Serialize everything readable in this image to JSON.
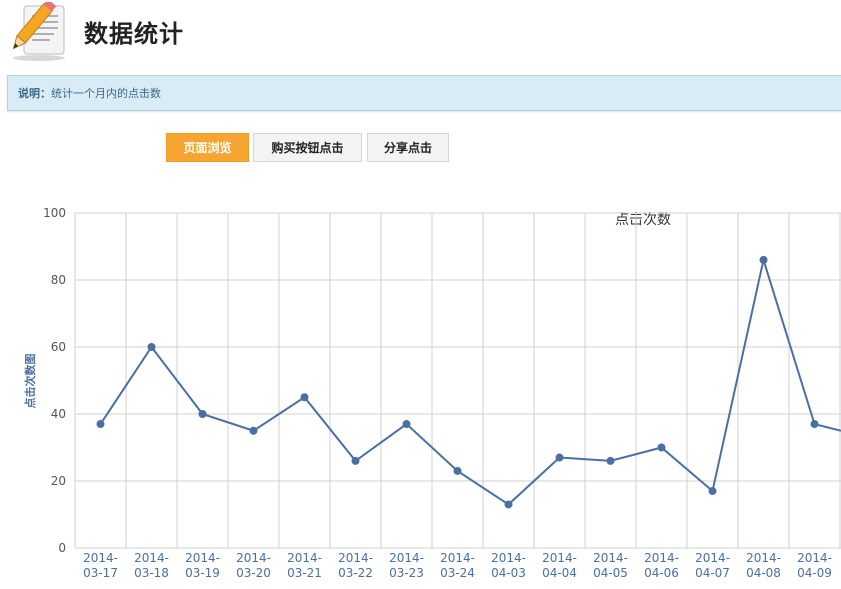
{
  "header": {
    "title": "数据统计",
    "logo_icon": "pencil-notepad-icon"
  },
  "info": {
    "label": "说明：",
    "text": "统计一个月内的点击数"
  },
  "tabs": [
    {
      "label": "页面浏览",
      "active": true
    },
    {
      "label": "购买按钮点击",
      "active": false
    },
    {
      "label": "分享点击",
      "active": false
    }
  ],
  "colors": {
    "accent": "#f7a532",
    "series": "#4a6fa5",
    "grid": "#d0d0d0",
    "axis_label": "#4a6fa5"
  },
  "chart_data": {
    "type": "line",
    "title": "点击次数",
    "ylabel": "点击次数图",
    "xlabel": "",
    "ylim": [
      0,
      100
    ],
    "yticks": [
      0,
      20,
      40,
      60,
      80,
      100
    ],
    "grid": true,
    "categories": [
      "2014-03-17",
      "2014-03-18",
      "2014-03-19",
      "2014-03-20",
      "2014-03-21",
      "2014-03-22",
      "2014-03-23",
      "2014-03-24",
      "2014-04-03",
      "2014-04-04",
      "2014-04-05",
      "2014-04-06",
      "2014-04-07",
      "2014-04-08",
      "2014-04-09"
    ],
    "values": [
      37,
      60,
      40,
      35,
      45,
      26,
      37,
      23,
      13,
      27,
      26,
      30,
      17,
      86,
      37
    ],
    "trailing_value": 35
  }
}
